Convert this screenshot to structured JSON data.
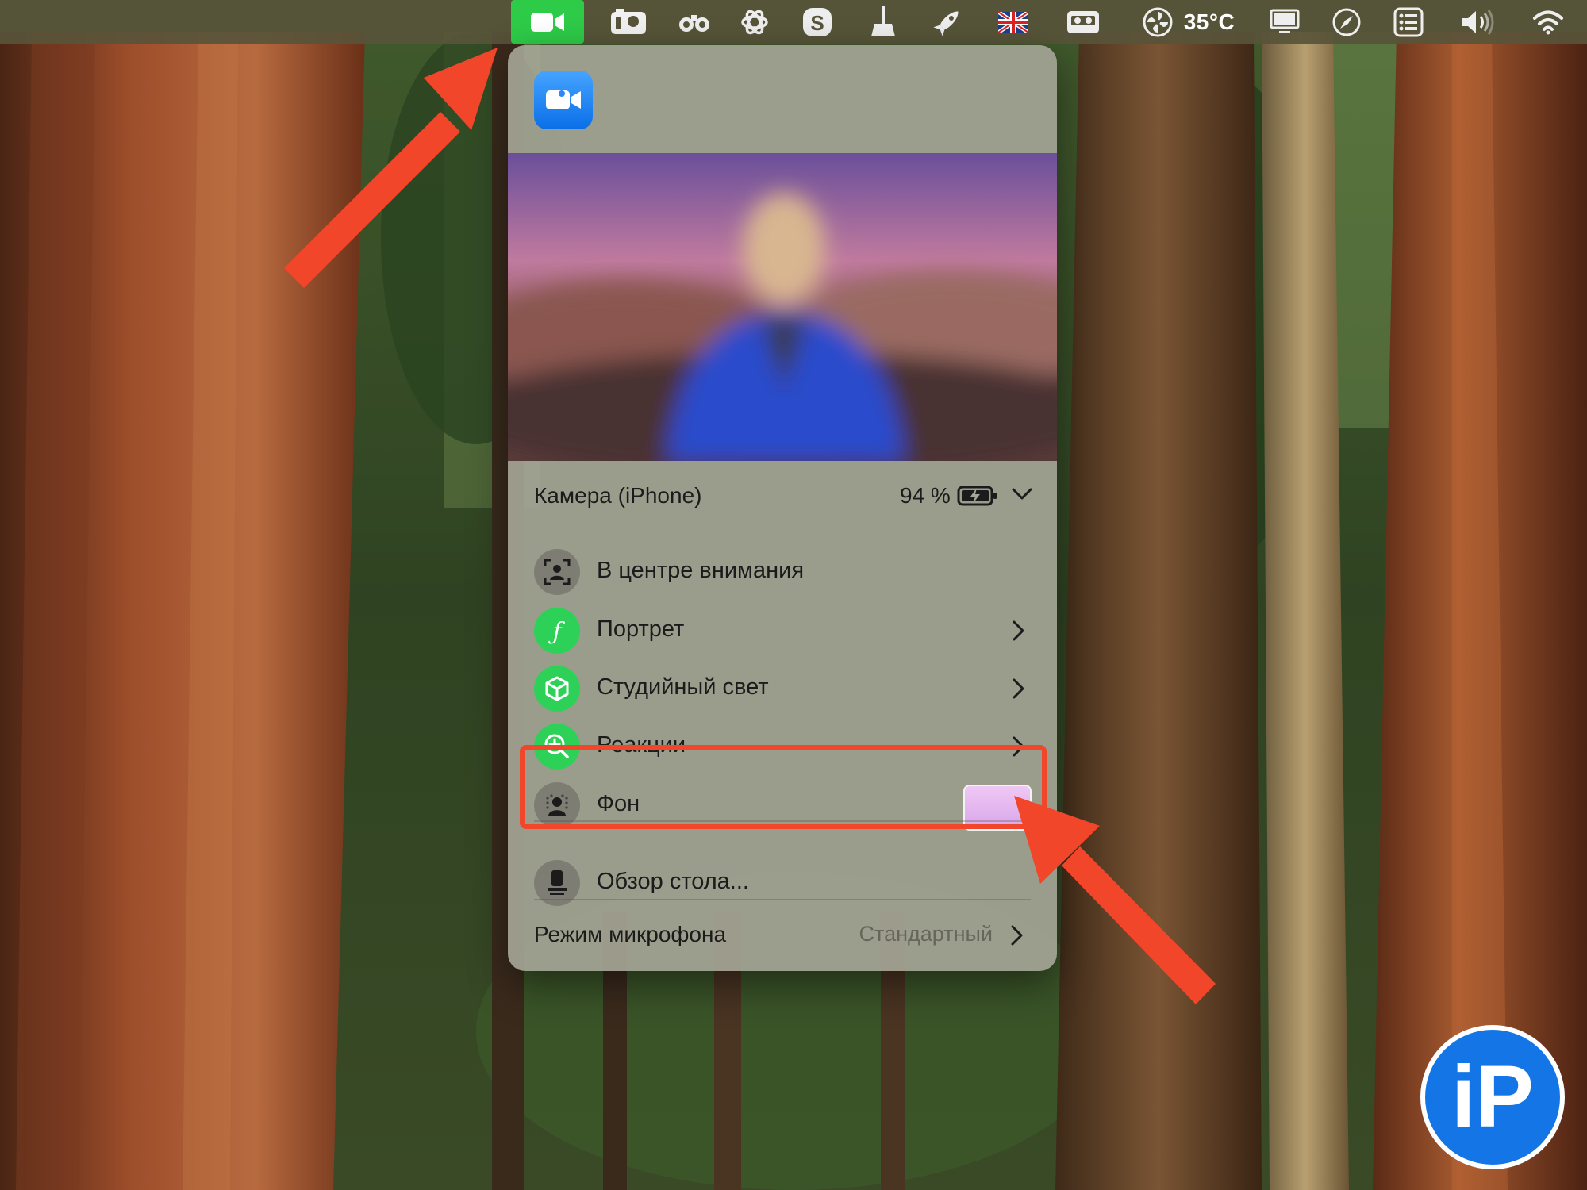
{
  "menubar": {
    "temperature": "35°C",
    "icons": [
      "video-camera-icon",
      "camera-app-icon",
      "binoculars-icon",
      "chatgpt-icon",
      "skype-icon",
      "broom-icon",
      "rocket-icon",
      "uk-flag-icon",
      "cassette-icon",
      "temperature-fan-icon",
      "display-icon",
      "compass-icon",
      "list-icon",
      "volume-icon",
      "wifi-icon"
    ],
    "active_color": "#2ecb48"
  },
  "panel": {
    "app_icon": "zoom-camera-icon",
    "camera_source": "Камера (iPhone)",
    "battery_percent": "94 %",
    "items": [
      {
        "label": "В центре внимания",
        "icon": "center-stage-icon"
      },
      {
        "label": "Портрет",
        "icon": "portrait-f-icon"
      },
      {
        "label": "Студийный свет",
        "icon": "studio-light-cube-icon"
      },
      {
        "label": "Реакции",
        "icon": "reactions-icon"
      },
      {
        "label": "Фон",
        "icon": "background-person-icon"
      },
      {
        "label": "Обзор стола...",
        "icon": "desk-view-icon"
      }
    ],
    "mic_mode_label": "Режим микрофона",
    "mic_mode_value": "Стандартный"
  },
  "annotations": {
    "highlight_color": "#f2462b"
  },
  "watermark": {
    "logo_text": "iP"
  }
}
